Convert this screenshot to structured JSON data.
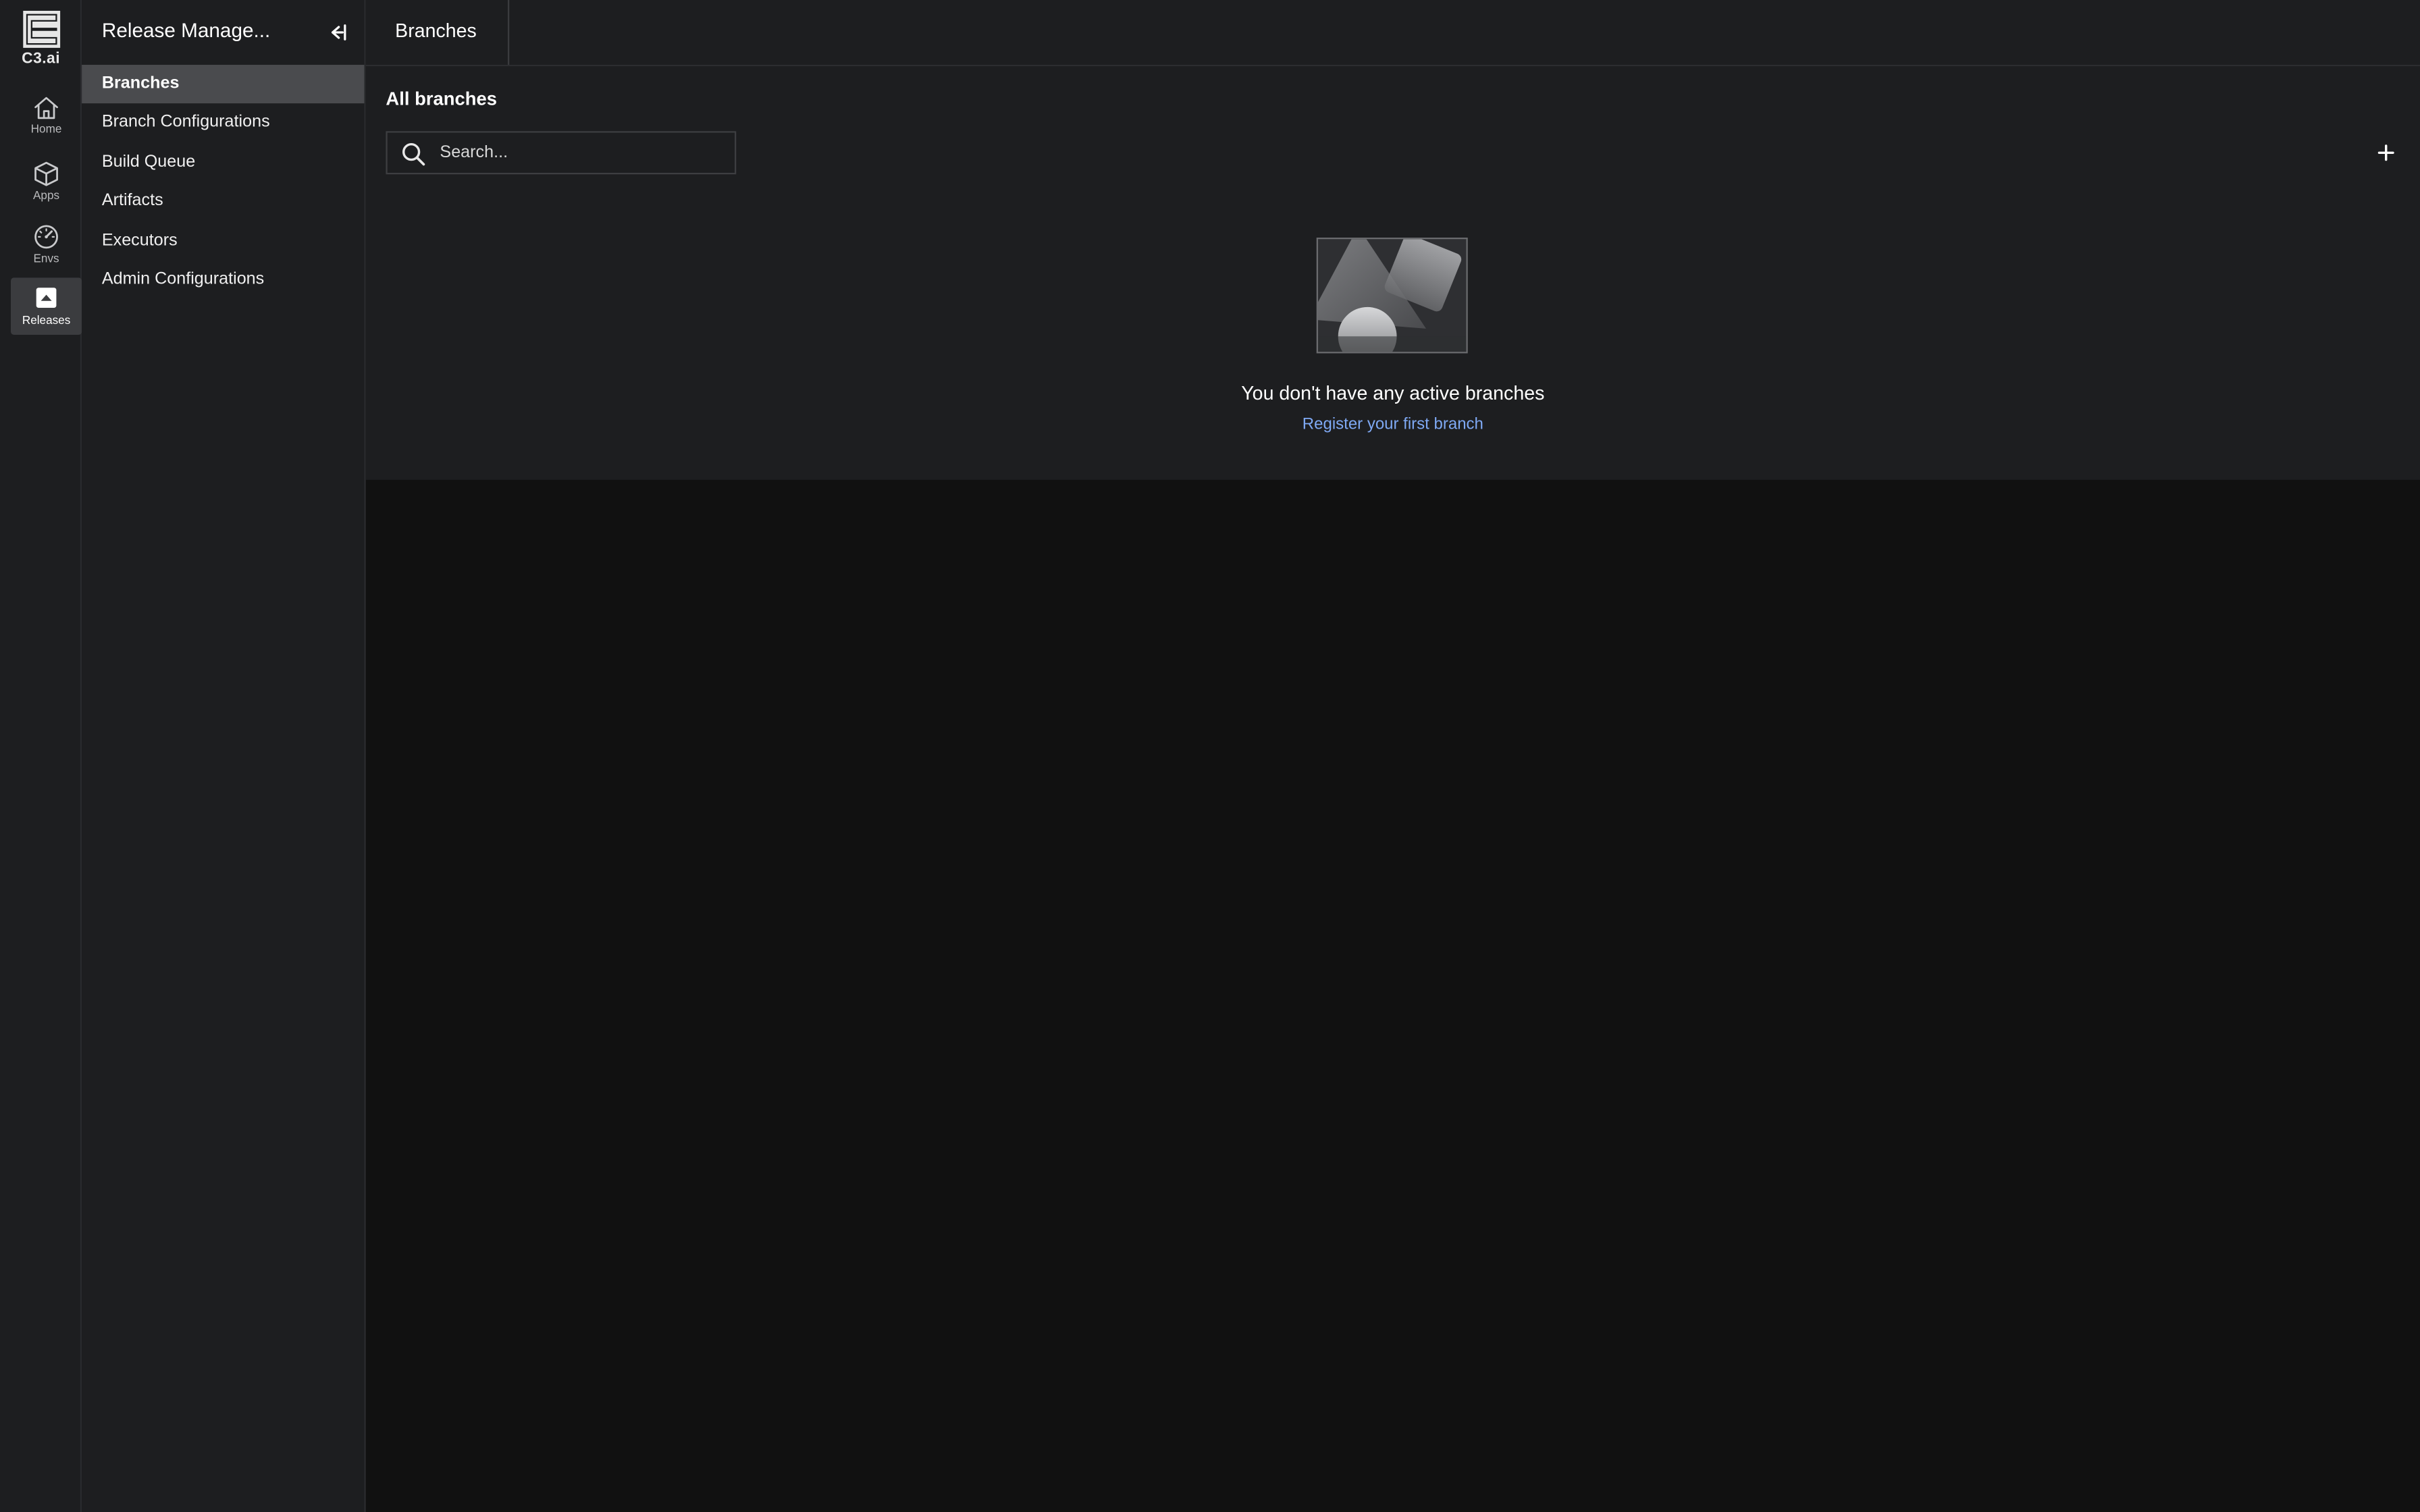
{
  "brand": {
    "name": "C3.ai"
  },
  "rail": {
    "items": [
      {
        "label": "Home",
        "icon": "home-icon",
        "active": false
      },
      {
        "label": "Apps",
        "icon": "cube-icon",
        "active": false
      },
      {
        "label": "Envs",
        "icon": "gauge-icon",
        "active": false
      },
      {
        "label": "Releases",
        "icon": "upload-icon",
        "active": true
      }
    ]
  },
  "sidebar": {
    "title": "Release Manage...",
    "collapse_icon": "collapse-left-icon",
    "items": [
      {
        "label": "Branches",
        "active": true
      },
      {
        "label": "Branch Configurations",
        "active": false
      },
      {
        "label": "Build Queue",
        "active": false
      },
      {
        "label": "Artifacts",
        "active": false
      },
      {
        "label": "Executors",
        "active": false
      },
      {
        "label": "Admin Configurations",
        "active": false
      }
    ]
  },
  "header": {
    "tab_label": "Branches"
  },
  "main": {
    "section_title": "All branches",
    "search": {
      "placeholder": "Search...",
      "value": ""
    },
    "add_icon": "plus-icon",
    "empty_state": {
      "title": "You don't have any active branches",
      "link": "Register your first branch"
    }
  },
  "colors": {
    "background": "#111111",
    "panel": "#1d1e20",
    "active_nav": "#4a4b4e",
    "link": "#7fa9f4"
  }
}
